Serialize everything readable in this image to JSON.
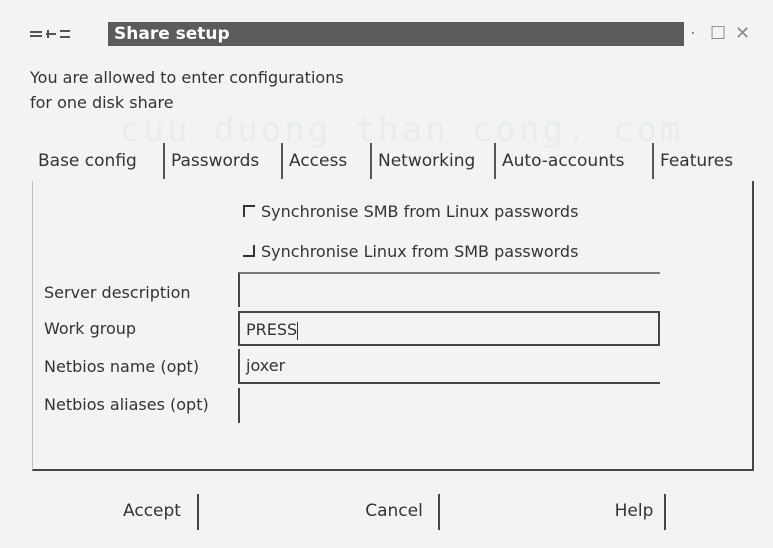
{
  "window": {
    "title": "Share setup",
    "controls": {
      "minimize": "·",
      "maximize": "☐",
      "close": "✕"
    }
  },
  "intro": {
    "line1": "You are allowed to enter configurations",
    "line2": "for one disk share"
  },
  "watermark": "cuu duong than cong. com",
  "tabs": [
    {
      "label": "Base config"
    },
    {
      "label": "Passwords"
    },
    {
      "label": "Access"
    },
    {
      "label": "Networking"
    },
    {
      "label": "Auto-accounts"
    },
    {
      "label": "Features"
    }
  ],
  "checkboxes": {
    "sync_smb": {
      "label": "Synchronise SMB from Linux passwords",
      "checked": true
    },
    "sync_linux": {
      "label": "Synchronise Linux from SMB passwords",
      "checked": false
    }
  },
  "fields": {
    "server_description": {
      "label": "Server description",
      "value": ""
    },
    "work_group": {
      "label": "Work group",
      "value": "PRESS"
    },
    "netbios_name": {
      "label": "Netbios name (opt)",
      "value": "joxer"
    },
    "netbios_aliases": {
      "label": "Netbios aliases (opt)",
      "value": ""
    }
  },
  "buttons": {
    "accept": "Accept",
    "cancel": "Cancel",
    "help": "Help"
  },
  "colors": {
    "titlebar": "#5b5b5b",
    "background": "#f3f3f1",
    "text": "#333333"
  }
}
